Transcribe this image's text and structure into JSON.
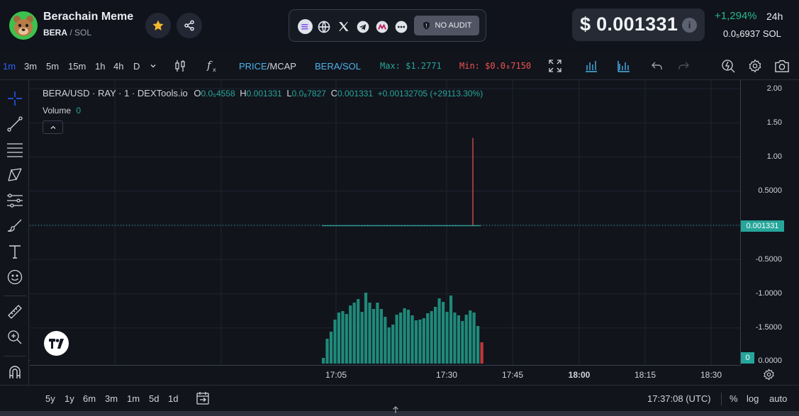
{
  "token": {
    "name": "Berachain Meme",
    "symbol": "BERA",
    "quote": "/ SOL"
  },
  "links": {
    "audit_label": "NO AUDIT"
  },
  "price": {
    "usd": "$ 0.001331",
    "change": "+1,294%",
    "period": "24h",
    "sol": "0.0₅6937 SOL"
  },
  "toolbar": {
    "intervals": [
      "1m",
      "3m",
      "5m",
      "15m",
      "1h",
      "4h",
      "D"
    ],
    "active_interval": "1m",
    "price_mcap_price": "PRICE",
    "price_mcap_sep": "/",
    "price_mcap_mcap": "MCAP",
    "pair_toggle": "BERA/SOL",
    "max_label": "Max: $1.2771",
    "min_label": "Min: $0.0₈7150"
  },
  "legend": {
    "symbol": "BERA/USD · RAY · 1 · DEXTools.io",
    "o_key": "O",
    "o_val": "0.0₅4558",
    "h_key": "H",
    "h_val": "0.001331",
    "l_key": "L",
    "l_val": "0.0₈7827",
    "c_key": "C",
    "c_val": "0.001331",
    "change_val": "+0.00132705 (+29113.30%)",
    "volume_label": "Volume",
    "volume_val": "0"
  },
  "price_scale": {
    "labels": [
      "2.00",
      "1.50",
      "1.00",
      "0.5000",
      "-0.5000",
      "-1.0000",
      "-1.5000",
      "0.0000"
    ],
    "current": "0.001331",
    "volume_current": "0"
  },
  "time_scale": {
    "labels": [
      "17:05",
      "17:30",
      "17:45",
      "18:00",
      "18:15",
      "18:30"
    ],
    "bold": [
      false,
      false,
      false,
      true,
      false,
      false
    ]
  },
  "bottom": {
    "ranges": [
      "5y",
      "1y",
      "6m",
      "3m",
      "1m",
      "5d",
      "1d"
    ],
    "clock": "17:37:08 (UTC)",
    "percent": "%",
    "log": "log",
    "auto": "auto"
  },
  "colors": {
    "up": "#26a69a",
    "down": "#ef5350",
    "price_line": "#26a69a",
    "accent": "#2962ff"
  },
  "chart_data": {
    "type": "bar",
    "title": "BERA/USD · RAY · 1 · DEXTools.io",
    "ylim": [
      -2.0,
      2.0
    ],
    "price_series": {
      "name": "price",
      "current": 0.001331,
      "spike_high": 1.2771
    },
    "volume_series": {
      "name": "Volume",
      "values": [
        0.08,
        0.35,
        0.45,
        0.62,
        0.72,
        0.74,
        0.7,
        0.82,
        0.86,
        0.91,
        0.73,
        1.0,
        0.86,
        0.77,
        0.86,
        0.77,
        0.66,
        0.51,
        0.55,
        0.69,
        0.72,
        0.78,
        0.76,
        0.68,
        0.61,
        0.62,
        0.64,
        0.71,
        0.74,
        0.8,
        0.92,
        0.87,
        0.73,
        0.96,
        0.72,
        0.68,
        0.6,
        0.69,
        0.75,
        0.72,
        0.53,
        0.3
      ],
      "down_last": true
    }
  }
}
